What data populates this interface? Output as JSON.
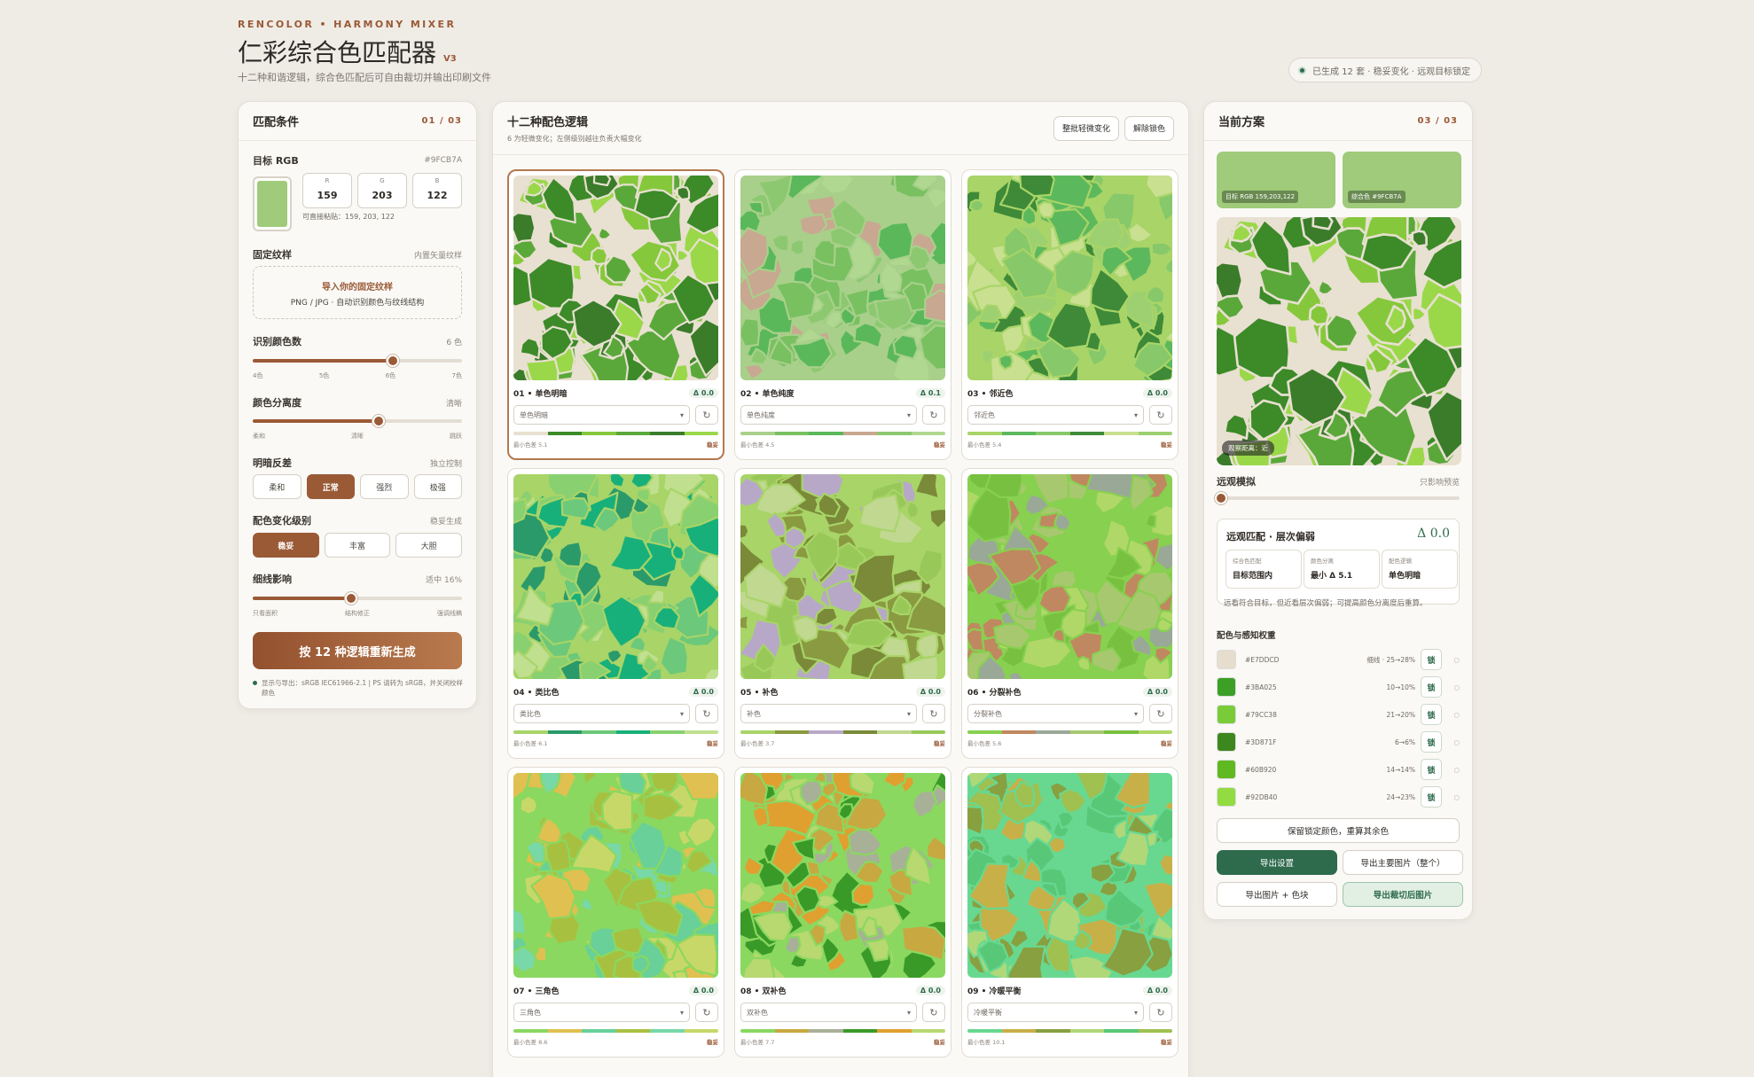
{
  "brand": "RENCOLOR • HARMONY MIXER",
  "app_title": "仁彩综合色匹配器",
  "version": "V3",
  "subtitle": "十二种和谐逻辑，综合色匹配后可自由裁切并输出印刷文件",
  "status": "已生成 12 套 · 稳妥变化 · 远观目标锁定",
  "left": {
    "title": "匹配条件",
    "count": "01 / 03",
    "target_label": "目标 RGB",
    "target_hex": "#9FCB7A",
    "rgb": [
      {
        "k": "R",
        "v": "159"
      },
      {
        "k": "G",
        "v": "203"
      },
      {
        "k": "B",
        "v": "122"
      }
    ],
    "paste_hint": "可直接粘贴：159, 203, 122",
    "texture_label": "固定纹样",
    "texture_hint": "内置矢量纹样",
    "upload_title": "导入你的固定纹样",
    "upload_sub": "PNG / JPG · 自动识别颜色与纹线结构",
    "colors_label": "识别颜色数",
    "colors_value": "6 色",
    "colors_ticks": [
      "4色",
      "5色",
      "6色",
      "7色"
    ],
    "colors_level": 0.67,
    "sep_label": "颜色分离度",
    "sep_value": "清晰",
    "sep_ticks": [
      "柔和",
      "清晰",
      "跳跃"
    ],
    "sep_level": 0.6,
    "contrast_label": "明暗反差",
    "contrast_hint": "独立控制",
    "contrast_opts": [
      "柔和",
      "正常",
      "强烈",
      "极强"
    ],
    "contrast_on": 1,
    "level_label": "配色变化级别",
    "level_hint": "稳妥生成",
    "level_opts": [
      "稳妥",
      "丰富",
      "大胆"
    ],
    "level_on": 0,
    "line_label": "细线影响",
    "line_value": "适中 16%",
    "line_ticks": [
      "只看面积",
      "结构修正",
      "强调线稿"
    ],
    "line_level": 0.47,
    "regen": "按 12 种逻辑重新生成",
    "foot": "显示与导出：sRGB IEC61966-2.1 | PS 请转为 sRGB，并关闭校样颜色"
  },
  "mid": {
    "title": "十二种配色逻辑",
    "sub": "6 为轻微变化；左侧级别越往负责大幅变化",
    "btn1": "整批轻微变化",
    "btn2": "解除锁色",
    "cards": [
      {
        "name": "01 • 单色明暗",
        "delta": "Δ 0.0",
        "select": "单色明暗",
        "min": "最小色差 5.1",
        "tag": "稳妥",
        "colors": [
          "#e8e0d0",
          "#3c8a28",
          "#86c83c",
          "#5aa83a",
          "#3a7c2a",
          "#9ad84a"
        ]
      },
      {
        "name": "02 • 单色纯度",
        "delta": "Δ 0.1",
        "select": "单色纯度",
        "min": "最小色差 4.5",
        "tag": "稳妥",
        "colors": [
          "#a8d08a",
          "#78c060",
          "#5ab85a",
          "#c8a890",
          "#8cc870",
          "#b0d890"
        ]
      },
      {
        "name": "03 • 邻近色",
        "delta": "Δ 0.0",
        "select": "邻近色",
        "min": "最小色差 5.4",
        "tag": "稳妥",
        "colors": [
          "#a8d468",
          "#5cb85c",
          "#86c86a",
          "#3e8a38",
          "#c8e090",
          "#9cd070"
        ]
      },
      {
        "name": "04 • 类比色",
        "delta": "Δ 0.0",
        "select": "类比色",
        "min": "最小色差 6.1",
        "tag": "稳妥",
        "colors": [
          "#a8d468",
          "#2a9a6a",
          "#6cc87a",
          "#18b07a",
          "#88d070",
          "#c0e090"
        ]
      },
      {
        "name": "05 • 补色",
        "delta": "Δ 0.0",
        "select": "补色",
        "min": "最小色差 3.7",
        "tag": "稳妥",
        "colors": [
          "#a8d468",
          "#8a9a40",
          "#b8a8c8",
          "#7a8a38",
          "#c0d890",
          "#98c858"
        ]
      },
      {
        "name": "06 • 分裂补色",
        "delta": "Δ 0.0",
        "select": "分裂补色",
        "min": "最小色差 5.6",
        "tag": "稳妥",
        "colors": [
          "#88d050",
          "#c08860",
          "#9aa898",
          "#a8c870",
          "#78c040",
          "#b0d868"
        ]
      },
      {
        "name": "07 • 三角色",
        "delta": "Δ 0.0",
        "select": "三角色",
        "min": "最小色差 8.6",
        "tag": "稳妥",
        "colors": [
          "#8ad860",
          "#e0c050",
          "#68d098",
          "#a8c040",
          "#78d8a8",
          "#c8d868"
        ]
      },
      {
        "name": "08 • 双补色",
        "delta": "Δ 0.0",
        "select": "双补色",
        "min": "最小色差 7.7",
        "tag": "稳妥",
        "colors": [
          "#8ad860",
          "#c8a840",
          "#a8b098",
          "#3a9a28",
          "#e0a030",
          "#b8d870"
        ]
      },
      {
        "name": "09 • 冷暖平衡",
        "delta": "Δ 0.0",
        "select": "冷暖平衡",
        "min": "最小色差 10.1",
        "tag": "稳妥",
        "colors": [
          "#68d890",
          "#c8b048",
          "#88a040",
          "#b0d878",
          "#58c878",
          "#a0c050"
        ]
      }
    ]
  },
  "right": {
    "title": "当前方案",
    "count": "03 / 03",
    "sw1": "目标 RGB 159,203,122",
    "sw2": "综合色 #9FCB7A",
    "badge": "观察距离：近",
    "view_label": "远观模拟",
    "view_hint": "只影响预览",
    "view_level": 0.02,
    "box_title": "远观匹配 · 层次偏弱",
    "box_delta": "Δ 0.0",
    "minis": [
      {
        "k": "综合色匹配",
        "v": "目标范围内"
      },
      {
        "k": "颜色分离",
        "v": "最小 Δ 5.1"
      },
      {
        "k": "配色逻辑",
        "v": "单色明暗"
      }
    ],
    "note": "远看符合目标，但近看层次偏弱；可提高颜色分离度后重算。",
    "weights_label": "配色与感知权重",
    "weights": [
      {
        "hex": "#E7DDCD",
        "range": "细线 · 25→28%",
        "color": "#e7ddcd"
      },
      {
        "hex": "#3BA025",
        "range": "10→10%",
        "color": "#3ba025"
      },
      {
        "hex": "#79CC38",
        "range": "21→20%",
        "color": "#79cc38"
      },
      {
        "hex": "#3D871F",
        "range": "6→6%",
        "color": "#3d871f"
      },
      {
        "hex": "#60B920",
        "range": "14→14%",
        "color": "#60b920"
      },
      {
        "hex": "#92DB40",
        "range": "24→23%",
        "color": "#92db40"
      }
    ],
    "lock_label": "锁",
    "rest_btn": "保留锁定颜色，重算其余色",
    "exp1": "导出设置",
    "exp2": "导出主要图片（整个）",
    "exp3": "导出图片 + 色块",
    "exp4": "导出裁切后图片"
  }
}
